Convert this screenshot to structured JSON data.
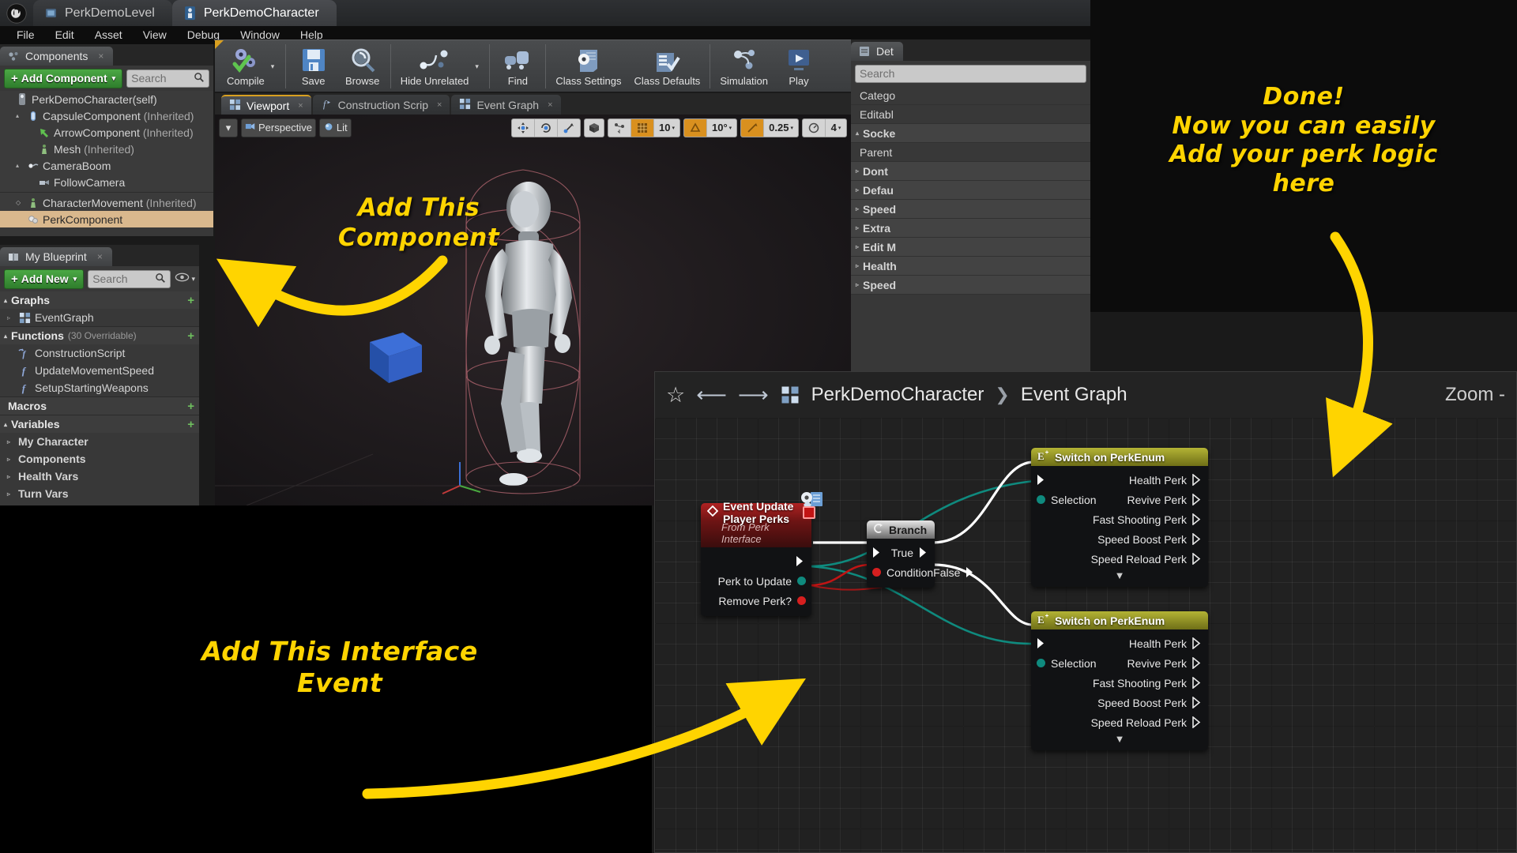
{
  "window": {
    "tabs": [
      {
        "label": "PerkDemoLevel",
        "icon": "level-icon",
        "active": false
      },
      {
        "label": "PerkDemoCharacter",
        "icon": "blueprint-icon",
        "active": true
      }
    ]
  },
  "menubar": {
    "items": [
      "File",
      "Edit",
      "Asset",
      "View",
      "Debug",
      "Window",
      "Help"
    ]
  },
  "components_panel": {
    "tab_label": "Components",
    "tab_icon": "components-icon",
    "add_component_label": "Add Component",
    "add_component_plus": "+",
    "add_component_caret": "▾",
    "search_placeholder": "Search",
    "search_icon": "search-icon",
    "tree": [
      {
        "label": "PerkDemoCharacter(self)",
        "icon": "blueprint-icon",
        "indent": 0,
        "arrow": "",
        "selected": false,
        "suffix": ""
      },
      {
        "label": "CapsuleComponent",
        "suffix": " (Inherited)",
        "icon": "capsule-icon",
        "indent": 1,
        "arrow": "▴",
        "selected": false
      },
      {
        "label": "ArrowComponent",
        "suffix": " (Inherited)",
        "icon": "arrow-comp-icon",
        "indent": 2,
        "arrow": "",
        "selected": false
      },
      {
        "label": "Mesh",
        "suffix": " (Inherited)",
        "icon": "mesh-icon",
        "indent": 2,
        "arrow": "",
        "selected": false
      },
      {
        "label": "CameraBoom",
        "suffix": "",
        "icon": "spring-arm-icon",
        "indent": 1,
        "arrow": "▴",
        "selected": false
      },
      {
        "label": "FollowCamera",
        "suffix": "",
        "icon": "camera-icon",
        "indent": 2,
        "arrow": "",
        "selected": false
      },
      {
        "label": "CharacterMovement",
        "suffix": " (Inherited)",
        "icon": "movement-icon",
        "indent": 1,
        "arrow": "◇",
        "selected": false
      },
      {
        "label": "PerkComponent",
        "suffix": "",
        "icon": "perk-comp-icon",
        "indent": 1,
        "arrow": "",
        "selected": true
      }
    ],
    "selection_color": "#d9b88d"
  },
  "blueprint_panel": {
    "tab_label": "My Blueprint",
    "tab_icon": "book-icon",
    "add_new_label": "Add New",
    "add_new_plus": "+",
    "add_new_caret": "▾",
    "search_placeholder": "Search",
    "eye_icon": "eye-icon",
    "sections": [
      {
        "title": "Graphs",
        "meta": "",
        "add": "+",
        "items": [
          {
            "label": "EventGraph",
            "icon": "graph-icon",
            "arrow": "▹"
          }
        ]
      },
      {
        "title": "Functions",
        "meta": "(30 Overridable)",
        "add": "+",
        "items": [
          {
            "label": "ConstructionScript",
            "icon": "construction-script-icon",
            "arrow": ""
          },
          {
            "label": "UpdateMovementSpeed",
            "icon": "function-icon",
            "arrow": ""
          },
          {
            "label": "SetupStartingWeapons",
            "icon": "function-icon",
            "arrow": ""
          }
        ]
      },
      {
        "title": "Macros",
        "meta": "",
        "add": "+",
        "items": []
      },
      {
        "title": "Variables",
        "meta": "",
        "add": "+",
        "items": [
          {
            "label": "My Character",
            "icon": "",
            "arrow": "▹",
            "bold": true
          },
          {
            "label": "Components",
            "icon": "",
            "arrow": "▹",
            "bold": true
          },
          {
            "label": "Health Vars",
            "icon": "",
            "arrow": "▹",
            "bold": true
          },
          {
            "label": "Turn Vars",
            "icon": "",
            "arrow": "▹",
            "bold": true
          }
        ]
      }
    ]
  },
  "toolbar": {
    "buttons": [
      {
        "label": "Compile",
        "icon": "compile-icon",
        "has_caret": true
      },
      {
        "label": "Save",
        "icon": "save-icon",
        "has_caret": false
      },
      {
        "label": "Browse",
        "icon": "browse-icon",
        "has_caret": false
      },
      {
        "label": "Hide Unrelated",
        "icon": "hide-unrelated-icon",
        "has_caret": true
      },
      {
        "label": "Find",
        "icon": "find-icon",
        "has_caret": false
      },
      {
        "label": "Class Settings",
        "icon": "class-settings-icon",
        "has_caret": false
      },
      {
        "label": "Class Defaults",
        "icon": "class-defaults-icon",
        "has_caret": false
      },
      {
        "label": "Simulation",
        "icon": "simulation-icon",
        "has_caret": false
      },
      {
        "label": "Play",
        "icon": "play-icon",
        "has_caret": false
      }
    ],
    "overflow_icon": "chevron-double-right-icon"
  },
  "editor_tabs": [
    {
      "label": "Viewport",
      "icon": "viewport-icon",
      "active": true
    },
    {
      "label": "Construction Scrip",
      "icon": "construction-script-icon",
      "active": false
    },
    {
      "label": "Event Graph",
      "icon": "graph-icon",
      "active": false
    }
  ],
  "viewport_toolbar": {
    "view_menu_caret": "▾",
    "perspective_label": "Perspective",
    "perspective_icon": "camera-icon",
    "lit_label": "Lit",
    "lit_icon": "lit-icon",
    "transform_icons": [
      "translate-icon",
      "rotate-icon",
      "scale-icon"
    ],
    "coord_icon": "world-coords-icon",
    "snap_icon": "surface-snap-icon",
    "grid_snap_icon": "grid-snap-icon",
    "grid_size": "10",
    "rotation_snap_icon": "rotation-snap-icon",
    "rotation_value": "10°",
    "scale_snap_icon": "scale-snap-icon",
    "scale_value": "0.25",
    "camera_speed_icon": "camera-speed-icon",
    "camera_speed": "4"
  },
  "details_panel": {
    "tab_label": "Det",
    "search_placeholder": "Search",
    "rows": [
      {
        "label": "Catego",
        "cat": false,
        "arrow": ""
      },
      {
        "label": "Editabl",
        "cat": false,
        "arrow": ""
      },
      {
        "label": "Socke",
        "cat": true,
        "arrow": "▴"
      },
      {
        "label": "Parent",
        "cat": false,
        "arrow": ""
      },
      {
        "label": "Dont",
        "cat": true,
        "arrow": "▹"
      },
      {
        "label": "Defau",
        "cat": true,
        "arrow": "▹"
      },
      {
        "label": "Speed",
        "cat": true,
        "arrow": "▹"
      },
      {
        "label": "Extra",
        "cat": true,
        "arrow": "▹"
      },
      {
        "label": "Edit M",
        "cat": true,
        "arrow": "▹"
      },
      {
        "label": "Health",
        "cat": true,
        "arrow": "▹"
      },
      {
        "label": "Speed",
        "cat": true,
        "arrow": "▹"
      }
    ]
  },
  "annotations": [
    {
      "id": "annot-add-component",
      "text": "Add This\nComponent",
      "color": "#ffd400",
      "size": 31
    },
    {
      "id": "annot-done",
      "text": "Done!\nNow you can easily\nAdd your perk logic\nhere",
      "color": "#ffd400",
      "size": 30
    },
    {
      "id": "annot-interface-event",
      "text": "Add This Interface\nEvent",
      "color": "#ffd400",
      "size": 33
    }
  ],
  "graph_window": {
    "star_icon": "favorite-star-icon",
    "back_icon": "back-arrow-icon",
    "forward_icon": "forward-arrow-icon",
    "graph_icon": "graph-icon",
    "breadcrumb": [
      "PerkDemoCharacter",
      "Event Graph"
    ],
    "breadcrumb_separator": "❯",
    "zoom_label": "Zoom -",
    "nodes": [
      {
        "id": "node-event-update-player-perks",
        "title": "Event Update Player Perks",
        "subtitle": "From Perk Interface",
        "header_type": "event",
        "header_color": "#b02222",
        "icon": "event-diamond-icon",
        "badge_icon": "interface-gear-icon",
        "outputs": [
          {
            "label": "",
            "pin": "exec"
          },
          {
            "label": "Perk to Update",
            "pin": "teal"
          },
          {
            "label": "Remove Perk?",
            "pin": "red"
          }
        ]
      },
      {
        "id": "node-branch",
        "title": "Branch",
        "subtitle": "",
        "header_type": "pure",
        "header_color": "#d0d0d0",
        "icon": "branch-icon",
        "inputs": [
          {
            "label": "",
            "pin": "exec"
          },
          {
            "label": "Condition",
            "pin": "red"
          }
        ],
        "outputs": [
          {
            "label": "True",
            "pin": "exec"
          },
          {
            "label": "False",
            "pin": "exec"
          }
        ]
      },
      {
        "id": "node-switch-on-perkenum-1",
        "title": "Switch on PerkEnum",
        "subtitle": "",
        "header_type": "enum",
        "header_color": "#b3b335",
        "icon": "enum-icon",
        "inputs": [
          {
            "label": "",
            "pin": "exec"
          },
          {
            "label": "Selection",
            "pin": "teal"
          }
        ],
        "outputs": [
          {
            "label": "Health Perk",
            "pin": "exec"
          },
          {
            "label": "Revive Perk",
            "pin": "exec"
          },
          {
            "label": "Fast Shooting Perk",
            "pin": "exec"
          },
          {
            "label": "Speed Boost Perk",
            "pin": "exec"
          },
          {
            "label": "Speed Reload Perk",
            "pin": "exec"
          }
        ],
        "expander": "▼"
      },
      {
        "id": "node-switch-on-perkenum-2",
        "title": "Switch on PerkEnum",
        "subtitle": "",
        "header_type": "enum",
        "header_color": "#b3b335",
        "icon": "enum-icon",
        "inputs": [
          {
            "label": "",
            "pin": "exec"
          },
          {
            "label": "Selection",
            "pin": "teal"
          }
        ],
        "outputs": [
          {
            "label": "Health Perk",
            "pin": "exec"
          },
          {
            "label": "Revive Perk",
            "pin": "exec"
          },
          {
            "label": "Fast Shooting Perk",
            "pin": "exec"
          },
          {
            "label": "Speed Boost Perk",
            "pin": "exec"
          },
          {
            "label": "Speed Reload Perk",
            "pin": "exec"
          }
        ],
        "expander": "▼"
      }
    ]
  },
  "colors": {
    "accent_orange": "#d9901f",
    "exec_white": "#ffffff",
    "enum_teal": "#0f8a7e",
    "bool_red": "#d61f1f",
    "annotation_yellow": "#ffd400",
    "selection_tan": "#d9b88d"
  }
}
